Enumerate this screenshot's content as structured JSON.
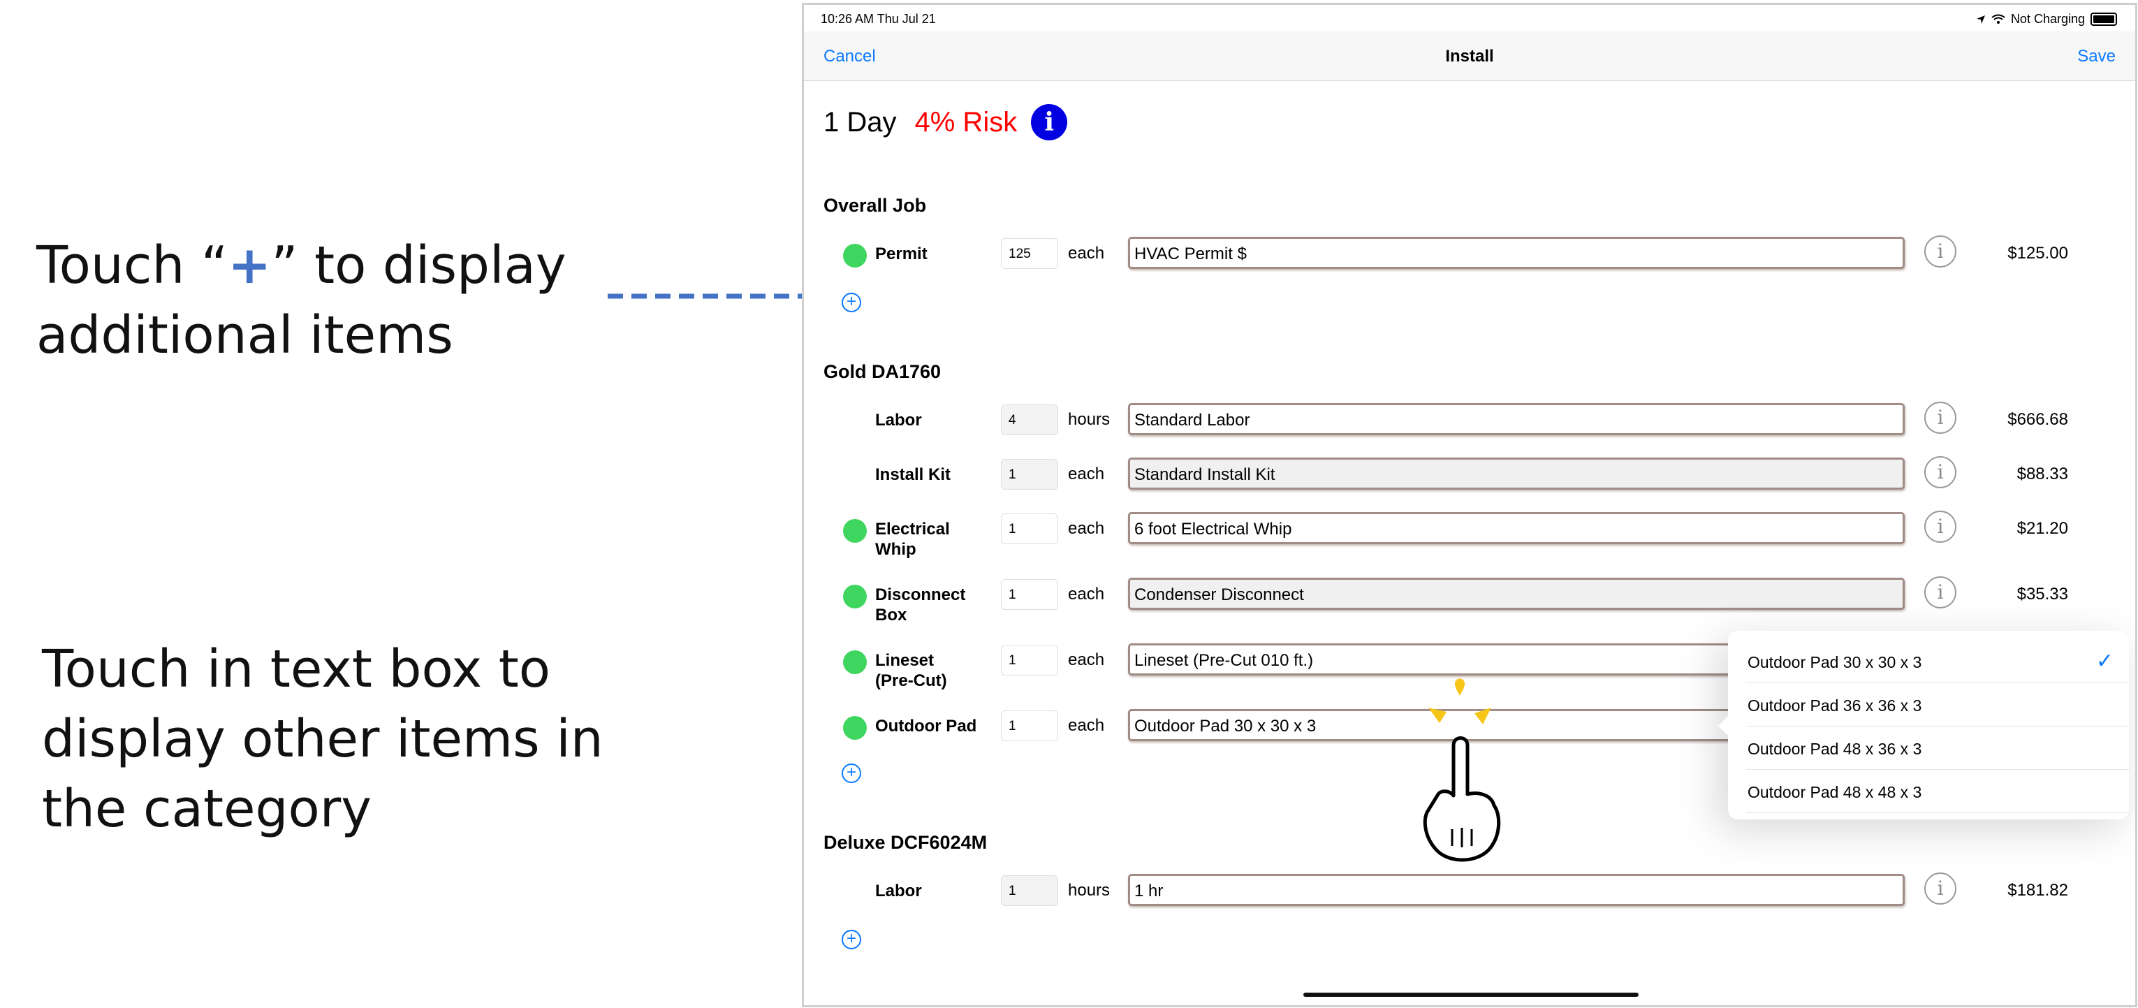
{
  "callouts": {
    "add": {
      "pre": "Touch “",
      "plus": "+",
      "post": "” to display additional items"
    },
    "textbox": "Touch in text box to display other items in the category"
  },
  "status": {
    "time": "10:26 AM   Thu Jul 21",
    "battery_text": "Not Charging"
  },
  "nav": {
    "cancel": "Cancel",
    "title": "Install",
    "save": "Save"
  },
  "summary": {
    "days": "1 Day",
    "risk": "4% Risk",
    "info_glyph": "i"
  },
  "sections": [
    {
      "title": "Overall Job",
      "rows": [
        {
          "has_dot": true,
          "label": "Permit",
          "qty": "125",
          "unit": "each",
          "desc": "HVAC Permit $",
          "price": "$125.00"
        }
      ]
    },
    {
      "title": "Gold DA1760",
      "rows": [
        {
          "has_dot": false,
          "label": "Labor",
          "qty": "4",
          "unit": "hours",
          "desc": "Standard Labor",
          "price": "$666.68"
        },
        {
          "has_dot": false,
          "label": "Install Kit",
          "qty": "1",
          "unit": "each",
          "desc": "Standard Install Kit",
          "price": "$88.33"
        },
        {
          "has_dot": true,
          "label": "Electrical\nWhip",
          "qty": "1",
          "unit": "each",
          "desc": "6 foot Electrical Whip",
          "price": "$21.20"
        },
        {
          "has_dot": true,
          "label": "Disconnect\nBox",
          "qty": "1",
          "unit": "each",
          "desc": "Condenser Disconnect",
          "price": "$35.33"
        },
        {
          "has_dot": true,
          "label": "Lineset\n(Pre-Cut)",
          "qty": "1",
          "unit": "each",
          "desc": "Lineset (Pre-Cut 010 ft.)",
          "price": ""
        },
        {
          "has_dot": true,
          "label": "Outdoor Pad",
          "qty": "1",
          "unit": "each",
          "desc": "Outdoor Pad 30 x 30 x 3",
          "price": ""
        }
      ]
    },
    {
      "title": "Deluxe DCF6024M",
      "rows": [
        {
          "has_dot": false,
          "label": "Labor",
          "qty": "1",
          "unit": "hours",
          "desc": "1 hr",
          "price": "$181.82"
        }
      ]
    }
  ],
  "add_glyph": "+",
  "row_info_glyph": "i",
  "dropdown": {
    "options": [
      "Outdoor Pad 30 x 30 x 3",
      "Outdoor Pad 36 x 36 x 3",
      "Outdoor Pad 48 x 36 x 3",
      "Outdoor Pad 48 x 48 x 3"
    ],
    "selected": "Outdoor Pad 30 x 30 x 3",
    "check_glyph": "✓"
  },
  "colors": {
    "accent": "#0a7aff",
    "risk": "#ff0000",
    "status_dot": "#3fd65f",
    "callout_plus": "#4472C4",
    "info_badge": "#0000e0"
  },
  "icons": [
    "location-arrow-icon",
    "wifi-icon",
    "battery-icon",
    "info-icon",
    "add-circle-icon",
    "checkmark-icon",
    "pointing-hand-icon",
    "dashed-arrow-icon"
  ]
}
